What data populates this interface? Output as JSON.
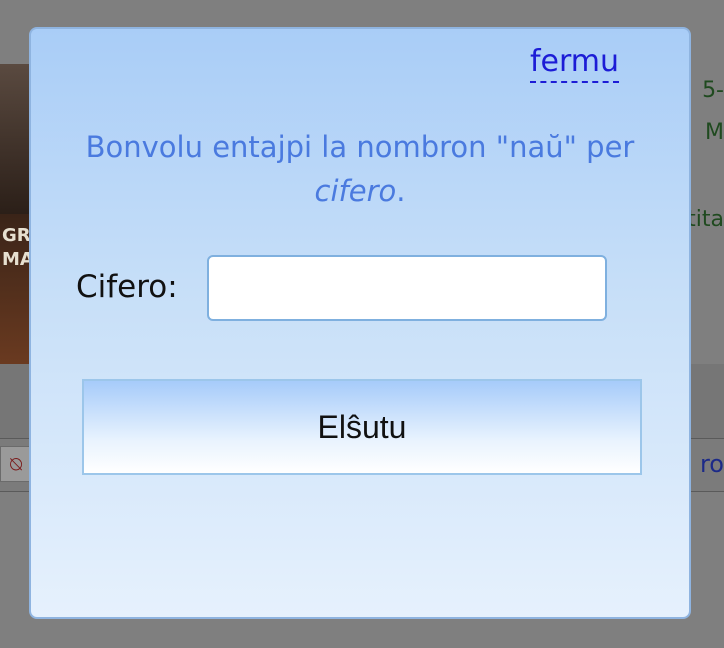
{
  "background": {
    "poster_text_1": "GRA",
    "poster_text_2": "MA",
    "right_line_1": "5-",
    "right_line_2": "M",
    "right_line_3": "tita",
    "row_text": "ro"
  },
  "dialog": {
    "close_label": "fermu",
    "prompt_main": "Bonvolu entajpi la nombron \"naŭ\" per",
    "prompt_emphasis": "cifero",
    "prompt_end": ".",
    "field_label": "Cifero:",
    "field_value": "",
    "submit_label": "Elŝutu"
  },
  "colors": {
    "modal_border": "#8fb4e0",
    "link": "#1c1cd6",
    "prompt_text": "#4a7adf"
  }
}
